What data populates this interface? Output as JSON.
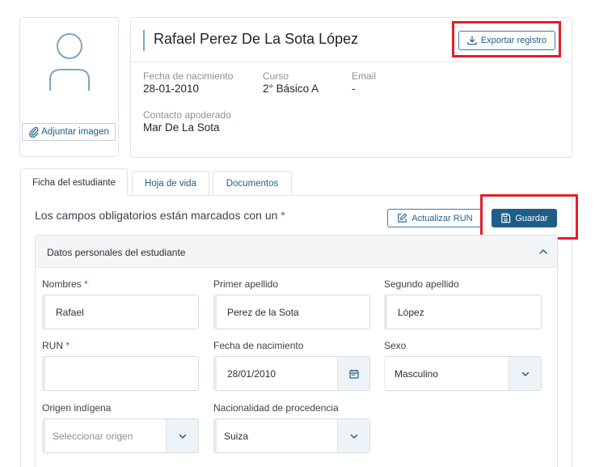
{
  "profile": {
    "attach_image_label": "Adjuntar imagen",
    "student_name": "Rafael Perez De La Sota López",
    "export_label": "Exportar registro",
    "fields": {
      "birth_label": "Fecha de nacimiento",
      "birth_value": "28-01-2010",
      "course_label": "Curso",
      "course_value": "2° Básico A",
      "email_label": "Email",
      "email_value": "-",
      "guardian_label": "Contacto apoderado",
      "guardian_value": "Mar De La Sota"
    }
  },
  "tabs": [
    {
      "label": "Ficha del estudiante",
      "active": true
    },
    {
      "label": "Hoja de vida",
      "active": false
    },
    {
      "label": "Documentos",
      "active": false
    }
  ],
  "toolbar": {
    "required_note": "Los campos obligatorios están marcados con un",
    "required_star": "*",
    "update_run_label": "Actualizar RUN",
    "save_label": "Guardar"
  },
  "section": {
    "title": "Datos personales del estudiante",
    "fields": {
      "nombres_label": "Nombres",
      "nombres_value": "Rafael",
      "primer_label": "Primer apellido",
      "primer_value": "Perez de la Sota",
      "segundo_label": "Segundo apellido",
      "segundo_value": "López",
      "run_label": "RUN",
      "run_value": "",
      "fecha_label": "Fecha de nacimiento",
      "fecha_value": "28/01/2010",
      "sexo_label": "Sexo",
      "sexo_value": "Masculino",
      "origen_label": "Origen indígena",
      "origen_placeholder": "Seleccionar origen",
      "nacionalidad_label": "Nacionalidad de procedencia",
      "nacionalidad_value": "Suiza"
    }
  },
  "colors": {
    "primary": "#1f5d89",
    "link": "#1d5f8a",
    "required": "#d9342b",
    "highlight": "#e0202a"
  }
}
